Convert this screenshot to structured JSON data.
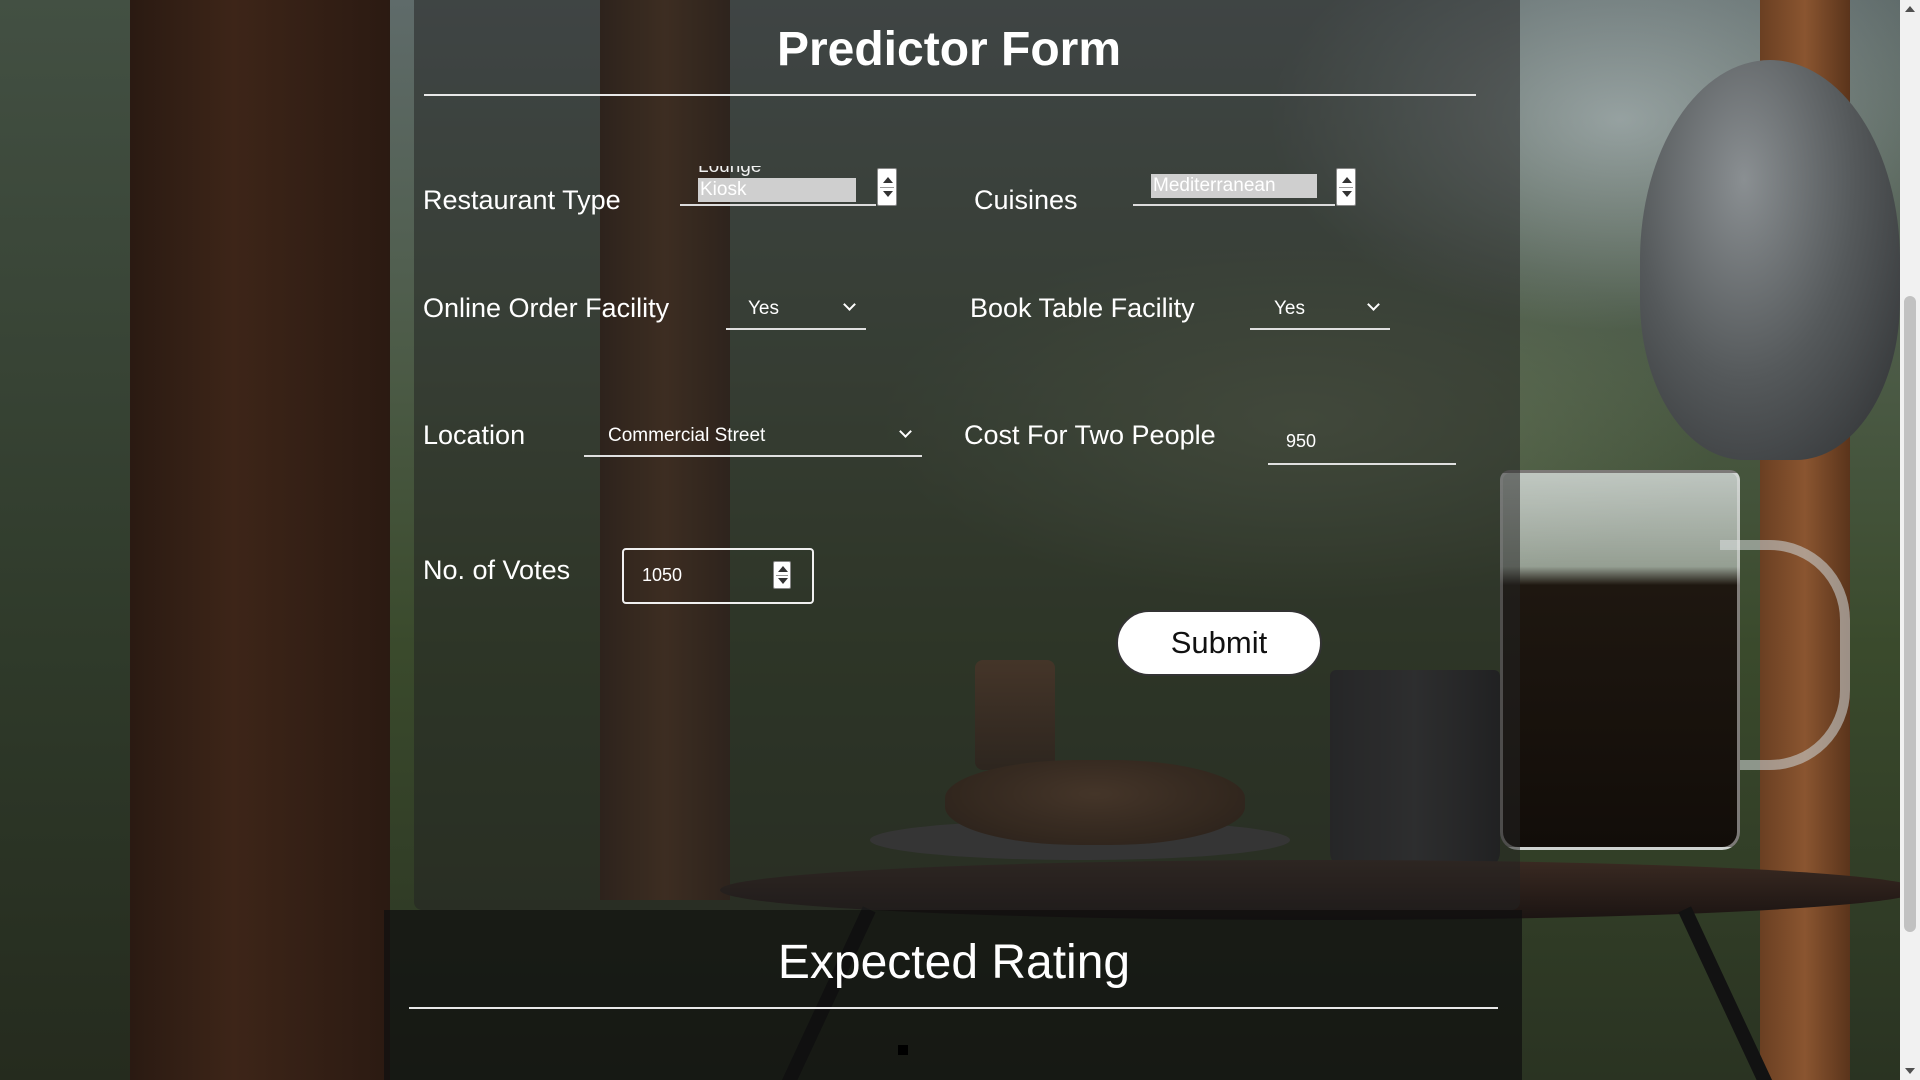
{
  "form": {
    "title": "Predictor Form",
    "restaurant_type": {
      "label": "Restaurant Type",
      "previous_option": "Lounge",
      "selected_option": "Kiosk"
    },
    "cuisines": {
      "label": "Cuisines",
      "previous_option": "",
      "selected_option": "Mediterranean"
    },
    "online_order": {
      "label": "Online Order Facility",
      "value": "Yes"
    },
    "book_table": {
      "label": "Book Table Facility",
      "value": "Yes"
    },
    "location": {
      "label": "Location",
      "value": "Commercial Street"
    },
    "cost_for_two": {
      "label": "Cost For Two People",
      "value": "950"
    },
    "votes": {
      "label": "No. of Votes",
      "value": "1050"
    },
    "submit_label": "Submit"
  },
  "result": {
    "title": "Expected Rating"
  },
  "colors": {
    "panel": "#232323",
    "text": "#ffffff",
    "button_bg": "#ffffff",
    "button_text": "#111111"
  }
}
